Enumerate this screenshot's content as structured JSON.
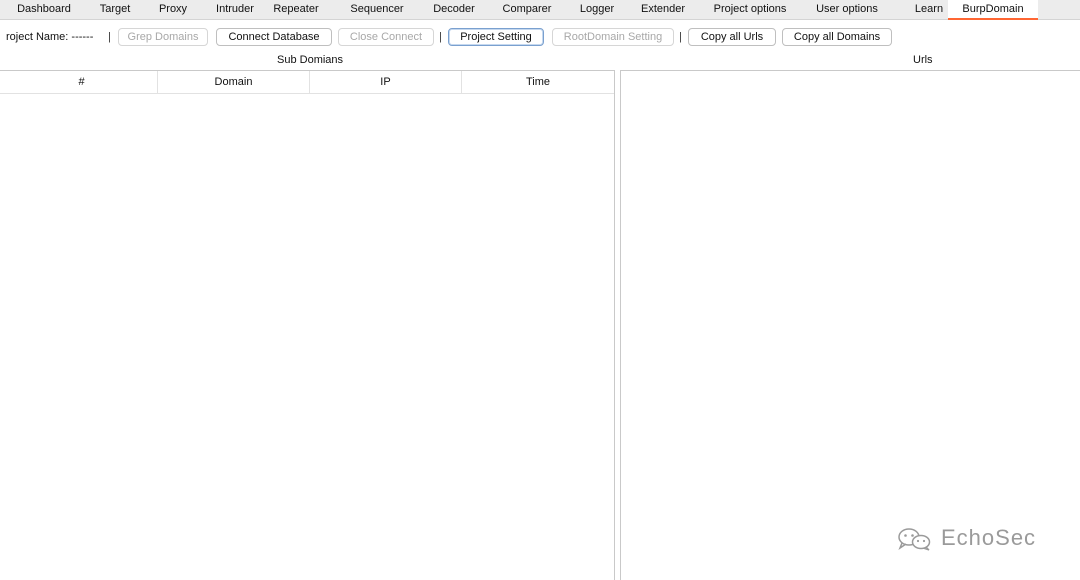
{
  "tabs": [
    {
      "label": "Dashboard"
    },
    {
      "label": "Target"
    },
    {
      "label": "Proxy"
    },
    {
      "label": "Intruder"
    },
    {
      "label": "Repeater"
    },
    {
      "label": "Sequencer"
    },
    {
      "label": "Decoder"
    },
    {
      "label": "Comparer"
    },
    {
      "label": "Logger"
    },
    {
      "label": "Extender"
    },
    {
      "label": "Project options"
    },
    {
      "label": "User options"
    },
    {
      "label": "Learn"
    },
    {
      "label": "BurpDomain",
      "active": true
    }
  ],
  "toolbar": {
    "project_name_label": "roject Name: ------",
    "separator": "|",
    "grep_domains": "Grep Domains",
    "connect_database": "Connect Database",
    "close_connect": "Close Connect",
    "project_setting": "Project Setting",
    "rootdomain_setting": "RootDomain Setting",
    "copy_all_urls": "Copy all Urls",
    "copy_all_domains": "Copy all Domains"
  },
  "subdomains": {
    "title": "Sub Domians",
    "columns": [
      "#",
      "Domain",
      "IP",
      "Time"
    ],
    "rows": []
  },
  "urls": {
    "title": "Urls",
    "items": []
  },
  "watermark": {
    "text": "EchoSec",
    "icon": "wechat-icon"
  },
  "colors": {
    "active_tab_underline": "#ff6633",
    "tabbar_bg": "#ececec",
    "disabled_text": "#a8a8a8"
  }
}
